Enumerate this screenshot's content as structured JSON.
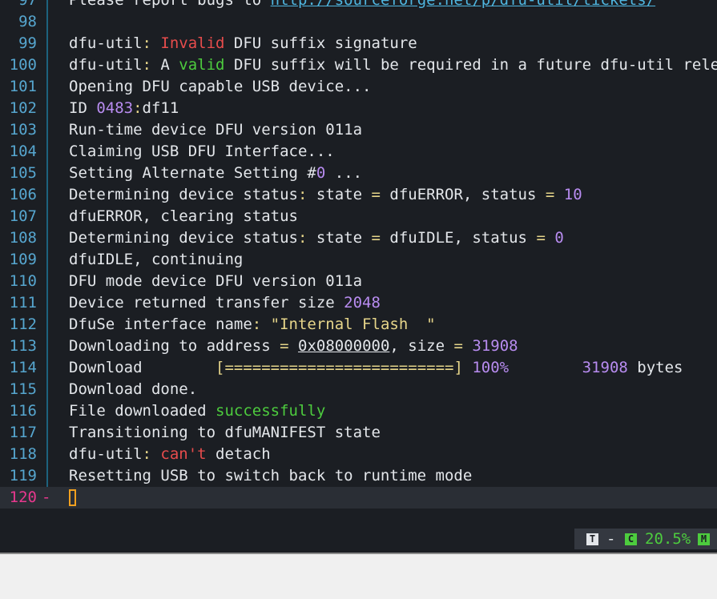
{
  "editor": {
    "lines": [
      {
        "n": "97",
        "segs": [
          {
            "t": "Please report bugs to "
          },
          {
            "t": "http://sourceforge.net/p/dfu-util/tickets/",
            "c": "link"
          }
        ]
      },
      {
        "n": "98",
        "segs": []
      },
      {
        "n": "99",
        "segs": [
          {
            "t": "dfu-util"
          },
          {
            "t": ": ",
            "c": "op"
          },
          {
            "t": "Invalid",
            "c": "red"
          },
          {
            "t": " DFU suffix signature"
          }
        ]
      },
      {
        "n": "100",
        "segs": [
          {
            "t": "dfu-util"
          },
          {
            "t": ": ",
            "c": "op"
          },
          {
            "t": "A "
          },
          {
            "t": "valid",
            "c": "green"
          },
          {
            "t": " DFU suffix will be required in a future dfu-util release"
          }
        ]
      },
      {
        "n": "101",
        "segs": [
          {
            "t": "Opening DFU capable USB device..."
          }
        ]
      },
      {
        "n": "102",
        "segs": [
          {
            "t": "ID "
          },
          {
            "t": "0483",
            "c": "purple"
          },
          {
            "t": ":",
            "c": "op"
          },
          {
            "t": "df11"
          }
        ]
      },
      {
        "n": "103",
        "segs": [
          {
            "t": "Run-time device DFU version 011a"
          }
        ]
      },
      {
        "n": "104",
        "segs": [
          {
            "t": "Claiming USB DFU Interface..."
          }
        ]
      },
      {
        "n": "105",
        "segs": [
          {
            "t": "Setting Alternate Setting #"
          },
          {
            "t": "0",
            "c": "purple"
          },
          {
            "t": " ..."
          }
        ]
      },
      {
        "n": "106",
        "segs": [
          {
            "t": "Determining device status"
          },
          {
            "t": ": ",
            "c": "op"
          },
          {
            "t": "state "
          },
          {
            "t": "=",
            "c": "op"
          },
          {
            "t": " dfuERROR, status "
          },
          {
            "t": "=",
            "c": "op"
          },
          {
            "t": " "
          },
          {
            "t": "10",
            "c": "purple"
          }
        ]
      },
      {
        "n": "107",
        "segs": [
          {
            "t": "dfuERROR, clearing status"
          }
        ]
      },
      {
        "n": "108",
        "segs": [
          {
            "t": "Determining device status"
          },
          {
            "t": ": ",
            "c": "op"
          },
          {
            "t": "state "
          },
          {
            "t": "=",
            "c": "op"
          },
          {
            "t": " dfuIDLE, status "
          },
          {
            "t": "=",
            "c": "op"
          },
          {
            "t": " "
          },
          {
            "t": "0",
            "c": "purple"
          }
        ]
      },
      {
        "n": "109",
        "segs": [
          {
            "t": "dfuIDLE, continuing"
          }
        ]
      },
      {
        "n": "110",
        "segs": [
          {
            "t": "DFU mode device DFU version 011a"
          }
        ]
      },
      {
        "n": "111",
        "segs": [
          {
            "t": "Device returned transfer size "
          },
          {
            "t": "2048",
            "c": "purple"
          }
        ]
      },
      {
        "n": "112",
        "segs": [
          {
            "t": "DfuSe interface name"
          },
          {
            "t": ": ",
            "c": "op"
          },
          {
            "t": "\"Internal Flash  \"",
            "c": "yellow"
          }
        ]
      },
      {
        "n": "113",
        "segs": [
          {
            "t": "Downloading to address "
          },
          {
            "t": "=",
            "c": "op"
          },
          {
            "t": " "
          },
          {
            "t": "0x08000000",
            "c": "ul"
          },
          {
            "t": ", size "
          },
          {
            "t": "=",
            "c": "op"
          },
          {
            "t": " "
          },
          {
            "t": "31908",
            "c": "purple"
          }
        ]
      },
      {
        "n": "114",
        "segs": [
          {
            "t": "Download        "
          },
          {
            "t": "[=========================]",
            "c": "op"
          },
          {
            "t": " "
          },
          {
            "t": "100%",
            "c": "purple"
          },
          {
            "t": "        "
          },
          {
            "t": "31908",
            "c": "purple"
          },
          {
            "t": " bytes"
          }
        ]
      },
      {
        "n": "115",
        "segs": [
          {
            "t": "Download done."
          }
        ]
      },
      {
        "n": "116",
        "segs": [
          {
            "t": "File downloaded "
          },
          {
            "t": "successfully",
            "c": "green"
          }
        ]
      },
      {
        "n": "117",
        "segs": [
          {
            "t": "Transitioning to dfuMANIFEST state"
          }
        ]
      },
      {
        "n": "118",
        "segs": [
          {
            "t": "dfu-util"
          },
          {
            "t": ": ",
            "c": "op"
          },
          {
            "t": "can't",
            "c": "red"
          },
          {
            "t": " detach"
          }
        ]
      },
      {
        "n": "119",
        "segs": [
          {
            "t": "Resetting USB to switch back to runtime mode"
          }
        ]
      },
      {
        "n": "120",
        "segs": [],
        "current": true,
        "cursor": true
      }
    ]
  },
  "statusbar": {
    "mode_badge": "T",
    "separator": "-",
    "column_badge": "C",
    "percent": "20.5%",
    "modified_badge": "M"
  },
  "colors": {
    "editor_bg": "#1b1e23",
    "current_line_bg": "#2a2e35",
    "gutter_number": "#56a6cf",
    "current_gutter": "#e8388e",
    "error": "#e74c4c",
    "success": "#4dcc3e",
    "number": "#b88cf0",
    "operator": "#e6d58a",
    "cursor": "#f0a020"
  }
}
